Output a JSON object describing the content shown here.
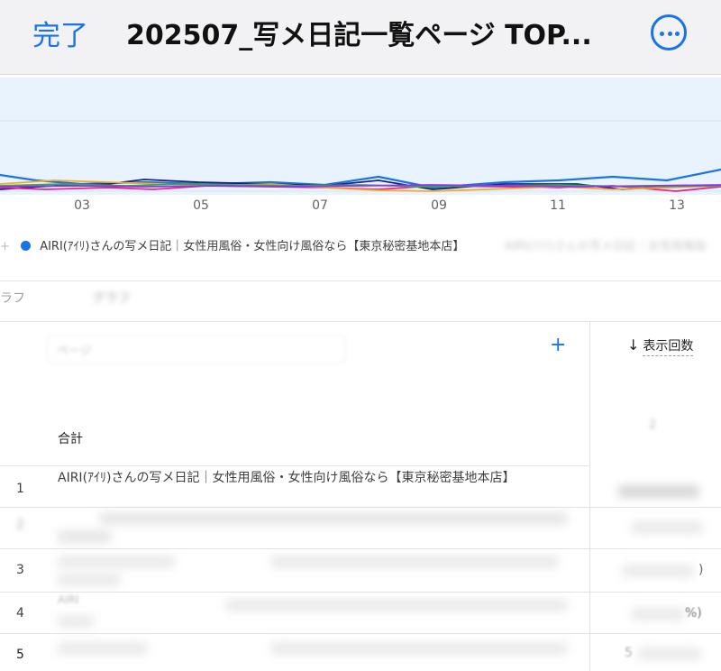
{
  "header": {
    "done_label": "完了",
    "title": "202507_写メ日記一覧ページ TOP...",
    "more_icon": "ellipsis-circle-icon"
  },
  "chart_data": {
    "type": "line",
    "x_tick_labels": [
      "03",
      "05",
      "07",
      "09",
      "11",
      "13"
    ],
    "series": [
      {
        "name": "AIRI(ｱｲﾘ)さんの写メ日記｜女性用風俗・女性向け風俗なら【東京秘密基地本店】",
        "color": "#1a73e8"
      }
    ],
    "colors": [
      "#1a73e8",
      "#1a237e",
      "#e52592",
      "#f9a825",
      "#34a853",
      "#9334e6"
    ]
  },
  "legend": {
    "item_1": "AIRI(ｱｲﾘ)さんの写メ日記｜女性用風俗・女性向け風俗なら【東京秘密基地本店】",
    "item_2_blurred": "AIRI(ｱｲﾘ)さんの写メ日記｜女性用風俗"
  },
  "toolbar": {
    "chip_label": "ラフ",
    "chip_blurred": "グラフ"
  },
  "table": {
    "search_placeholder": "ページ",
    "add_icon": "plus-icon",
    "sort_label": "表示回数",
    "total_label": "合計",
    "total_value": "2",
    "rows": [
      {
        "rank": "1",
        "title": "AIRI(ｱｲﾘ)さんの写メ日記｜女性用風俗・女性向け風俗なら【東京秘密基地本店】",
        "value": ""
      },
      {
        "rank": "2",
        "title": "",
        "value": ""
      },
      {
        "rank": "3",
        "title": "",
        "value": ")"
      },
      {
        "rank": "4",
        "title": "AIRI",
        "value": "%)"
      },
      {
        "rank": "5",
        "title": "",
        "value": "5"
      }
    ]
  }
}
